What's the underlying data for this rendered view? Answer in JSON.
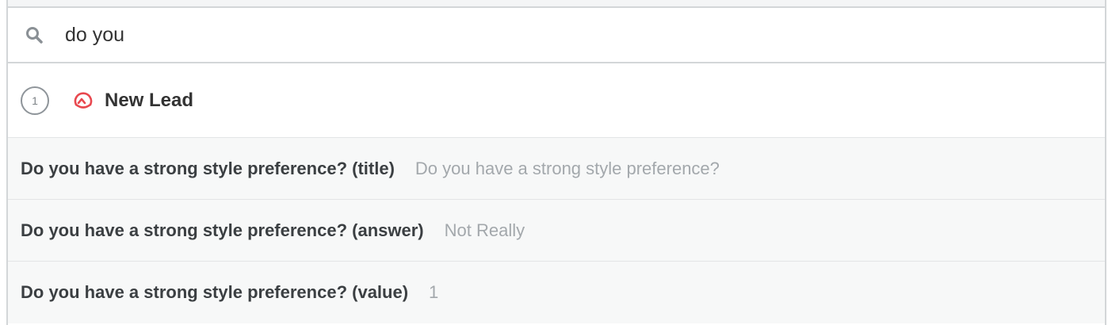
{
  "search": {
    "value": "do you",
    "icon": "search-icon"
  },
  "trigger": {
    "step_number": "1",
    "app_icon": "app-logo-icon",
    "title": "New Lead",
    "accent_color": "#e8484f"
  },
  "fields": [
    {
      "label": "Do you have a strong style preference? (title)",
      "value": "Do you have a strong style preference?"
    },
    {
      "label": "Do you have a strong style preference? (answer)",
      "value": "Not Really"
    },
    {
      "label": "Do you have a strong style preference? (value)",
      "value": "1"
    }
  ]
}
